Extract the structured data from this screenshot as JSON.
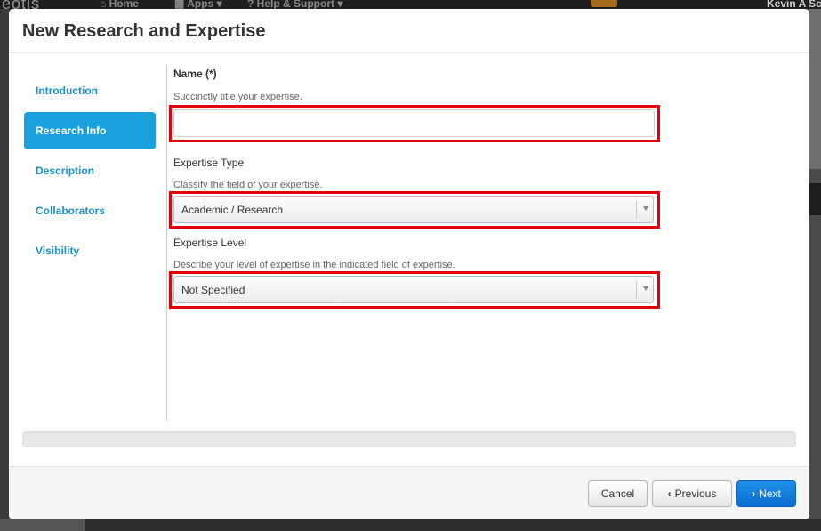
{
  "background": {
    "logo_text": "eotis",
    "nav_items": [
      "Home",
      "Apps",
      "Help & Support"
    ],
    "user_name": "Kevin A Sc"
  },
  "modal": {
    "title": "New Research and Expertise",
    "nav": [
      {
        "label": "Introduction",
        "active": false
      },
      {
        "label": "Research Info",
        "active": true
      },
      {
        "label": "Description",
        "active": false
      },
      {
        "label": "Collaborators",
        "active": false
      },
      {
        "label": "Visibility",
        "active": false
      }
    ],
    "form": {
      "name_label": "Name (*)",
      "name_help": "Succinctly title your expertise.",
      "name_value": "",
      "type_label": "Expertise Type",
      "type_help": "Classify the field of your expertise.",
      "type_value": "Academic / Research",
      "level_label": "Expertise Level",
      "level_help": "Describe your level of expertise in the indicated field of expertise.",
      "level_value": "Not Specified"
    },
    "footer": {
      "cancel_label": "Cancel",
      "previous_label": "Previous",
      "next_label": "Next"
    }
  },
  "colors": {
    "highlight": "#e4000b",
    "primary": "#1a7fe0",
    "nav_active": "#1aa1dd",
    "nav_link": "#1a91c9"
  }
}
